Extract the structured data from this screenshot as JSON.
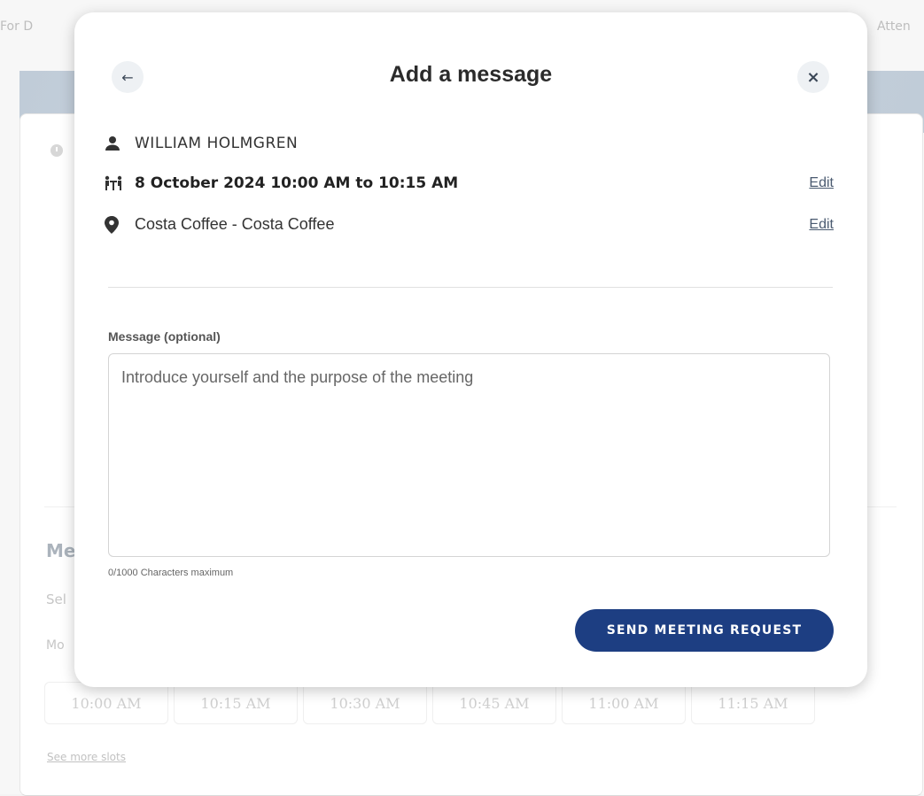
{
  "background": {
    "tab_left": "For D",
    "tab_right": "Atten",
    "section_heading": "Me",
    "section_subtext": "Sel",
    "day_label": "Mo",
    "time_slots": [
      "10:00 AM",
      "10:15 AM",
      "10:30 AM",
      "10:45 AM",
      "11:00 AM",
      "11:15 AM"
    ],
    "see_more_link": "See more slots"
  },
  "modal": {
    "title": "Add a message",
    "back_icon": "arrow-left-icon",
    "close_icon": "close-icon",
    "attendee_name": "WILLIAM HOLMGREN",
    "meeting_time": "8 October 2024 10:00 AM to 10:15 AM",
    "location": "Costa Coffee - Costa Coffee",
    "edit_time_label": "Edit",
    "edit_location_label": "Edit",
    "message_label": "Message (optional)",
    "message_placeholder": "Introduce yourself and the purpose of the meeting",
    "message_value": "",
    "char_counter": "0/1000 Characters maximum",
    "send_button_label": "SEND MEETING REQUEST"
  },
  "colors": {
    "primary_button": "#1d3e82",
    "banner": "#9fb1c4"
  }
}
